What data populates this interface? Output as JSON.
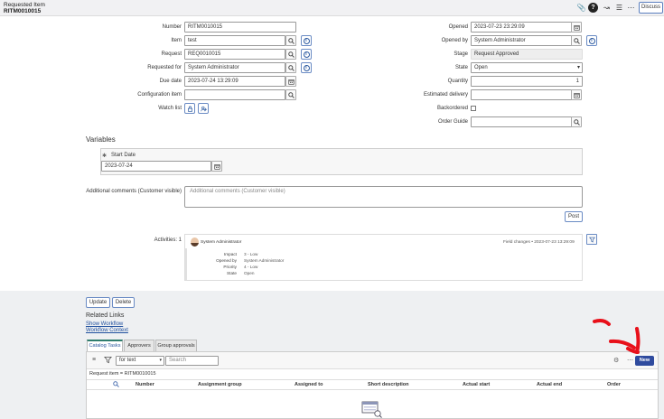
{
  "header": {
    "title_line1": "Requested Item",
    "title_line2": "RITM0010015",
    "discuss_label": "Discuss"
  },
  "form": {
    "left": [
      {
        "label": "Number",
        "value": "RITM0010015"
      },
      {
        "label": "Item",
        "value": "test"
      },
      {
        "label": "Request",
        "value": "REQ0010015"
      },
      {
        "label": "Requested for",
        "value": "System Administrator"
      },
      {
        "label": "Due date",
        "value": "2023-07-24 13:29:09"
      },
      {
        "label": "Configuration item",
        "value": ""
      },
      {
        "label": "Watch list",
        "value": ""
      }
    ],
    "right": [
      {
        "label": "Opened",
        "value": "2023-07-23 23:29:09"
      },
      {
        "label": "Opened by",
        "value": "System Administrator"
      },
      {
        "label": "Stage",
        "value": "Request Approved"
      },
      {
        "label": "State",
        "value": "Open"
      },
      {
        "label": "Quantity",
        "value": "1"
      },
      {
        "label": "Estimated delivery",
        "value": ""
      },
      {
        "label": "Backordered",
        "value": ""
      },
      {
        "label": "Order Guide",
        "value": ""
      }
    ]
  },
  "variables": {
    "section_title": "Variables",
    "start_date_label": "Start Date",
    "start_date_value": "2023-07-24"
  },
  "comments": {
    "label": "Additional comments (Customer visible)",
    "placeholder": "Additional comments (Customer visible)",
    "post_label": "Post"
  },
  "activities": {
    "label": "Activities: 1",
    "author": "System Administrator",
    "meta": "Field changes  •  2023-07-23 13:29:09",
    "changes": [
      {
        "key": "Impact",
        "value": "3 - Low"
      },
      {
        "key": "Opened by",
        "value": "System Administrator"
      },
      {
        "key": "Priority",
        "value": "4 - Low"
      },
      {
        "key": "State",
        "value": "Open"
      }
    ]
  },
  "actions": {
    "update_label": "Update",
    "delete_label": "Delete"
  },
  "related_links": {
    "title": "Related Links",
    "links": [
      "Show Workflow",
      "Workflow Context"
    ]
  },
  "related_list": {
    "tabs": [
      "Catalog Tasks",
      "Approvers",
      "Group approvals"
    ],
    "search_field_value": "for text",
    "search_placeholder": "Search",
    "new_label": "New",
    "breadcrumb": "Request item = RITM0010015",
    "columns": [
      "Number",
      "Assignment group",
      "Assigned to",
      "Short description",
      "Actual start",
      "Actual end",
      "Order"
    ]
  },
  "colors": {
    "accent": "#2f4b9e",
    "link": "#1f4f9e",
    "annotation_arrow": "#e8101a"
  }
}
